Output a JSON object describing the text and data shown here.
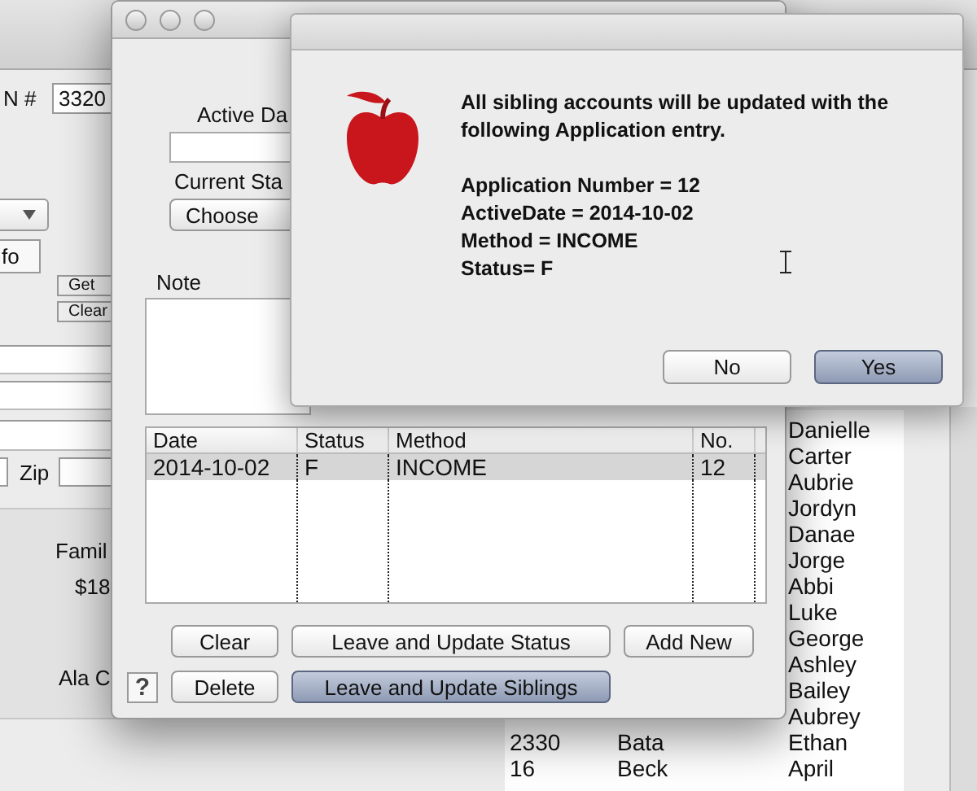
{
  "background_window": {
    "account_label": "N #",
    "account_value": "3320",
    "info_button": "fo",
    "small_buttons": [
      "Get",
      "Clear"
    ],
    "zip_label": "Zip",
    "family_label": "Famil",
    "family_amount": "$18",
    "ala_label": "Ala C",
    "list_rows": [
      {
        "first": "Danielle"
      },
      {
        "first": "Carter"
      },
      {
        "first": "Aubrie"
      },
      {
        "first": "Jordyn"
      },
      {
        "first": "Danae"
      },
      {
        "first": "Jorge"
      },
      {
        "first": "Abbi"
      },
      {
        "first": "Luke"
      },
      {
        "first": "George"
      },
      {
        "first": "Ashley"
      },
      {
        "first": "Bailey"
      },
      {
        "first": "Aubrey"
      },
      {
        "number": "2330",
        "surname": "Bata",
        "first": "Ethan"
      },
      {
        "number": "16",
        "surname": "Beck",
        "first": "April"
      }
    ]
  },
  "application_window": {
    "active_date_label": "Active Da",
    "status_label": "Current Sta",
    "status_choice": "Choose",
    "note_label": "Note",
    "table": {
      "columns": [
        "Date",
        "Status",
        "Method",
        "No."
      ],
      "rows": [
        {
          "cells": [
            "2014-10-02",
            "F",
            "INCOME",
            "12"
          ],
          "selected": true
        }
      ]
    },
    "help_button": "?",
    "buttons": [
      {
        "label": "Clear",
        "default": false
      },
      {
        "label": "Leave and Update Status",
        "default": false
      },
      {
        "label": "Add New",
        "default": false
      },
      {
        "label": "Delete",
        "default": false
      },
      {
        "label": "Leave and Update Siblings",
        "default": true
      }
    ]
  },
  "alert": {
    "message": "All sibling accounts will be updated with the following Application entry.",
    "details": [
      "Application Number = 12",
      "ActiveDate = 2014-10-02",
      "Method = INCOME",
      "Status= F"
    ],
    "buttons": [
      {
        "label": "No",
        "default": false
      },
      {
        "label": "Yes",
        "default": true
      }
    ]
  }
}
